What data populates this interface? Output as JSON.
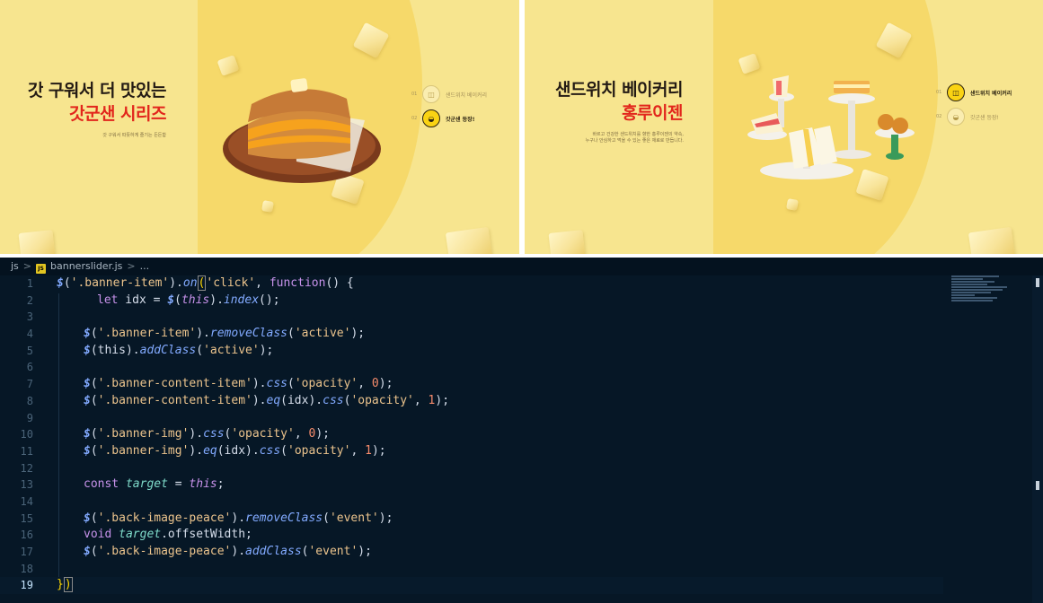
{
  "banner_left": {
    "title_line1": "갓 구워서 더 맛있는",
    "title_line2": "갓군샌 시리즈",
    "subtitle": "갓 구워서 따뜻하게 즐기는 든든함",
    "nav": [
      {
        "num": "01",
        "label": "샌드위치 베이커리",
        "active": false
      },
      {
        "num": "02",
        "label": "갓군샌 등장!",
        "active": true
      }
    ]
  },
  "banner_right": {
    "title_line1": "샌드위치 베이커리",
    "title_line2": "홍루이젠",
    "subtitle_line1": "바르고 건강한 샌드위치를 향한 홍루이젠의 약속,",
    "subtitle_line2": "누구나 안심하고 먹을 수 있는 좋은 재료로 만듭니다.",
    "nav": [
      {
        "num": "01",
        "label": "샌드위치 베이커리",
        "active": true
      },
      {
        "num": "02",
        "label": "갓군샌 등장!",
        "active": false
      }
    ]
  },
  "editor": {
    "breadcrumb": [
      "js",
      "bannerslider.js",
      "..."
    ],
    "file_badge": "JS",
    "line_numbers": [
      "1",
      "2",
      "3",
      "4",
      "5",
      "6",
      "7",
      "8",
      "9",
      "10",
      "11",
      "12",
      "13",
      "14",
      "15",
      "16",
      "17",
      "18",
      "19"
    ],
    "current_line": 19,
    "code": {
      "l1": {
        "dollar": "$",
        "p1": "(",
        "s1": "'.banner-item'",
        "p2": ").",
        "fn": "on",
        "brk": "(",
        "s2": "'click'",
        "p3": ", ",
        "kw": "function",
        "p4": "() {"
      },
      "l2": {
        "kw": "let",
        "v": " idx = ",
        "dollar": "$",
        "p1": "(",
        "this": "this",
        "p2": ").",
        "fn": "index",
        "p3": "();"
      },
      "l4": {
        "dollar": "$",
        "p1": "(",
        "s1": "'.banner-item'",
        "p2": ").",
        "fn": "removeClass",
        "p3": "(",
        "s2": "'active'",
        "p4": ");"
      },
      "l5": {
        "dollar": "$",
        "p1": "(this).",
        "fn": "addClass",
        "p2": "(",
        "s1": "'active'",
        "p3": ");"
      },
      "l7": {
        "dollar": "$",
        "p1": "(",
        "s1": "'.banner-content-item'",
        "p2": ").",
        "fn": "css",
        "p3": "(",
        "s2": "'opacity'",
        "p4": ", ",
        "n": "0",
        "p5": ");"
      },
      "l8": {
        "dollar": "$",
        "p1": "(",
        "s1": "'.banner-content-item'",
        "p2": ").",
        "fn": "eq",
        "p3": "(idx).",
        "fn2": "css",
        "p4": "(",
        "s2": "'opacity'",
        "p5": ", ",
        "n": "1",
        "p6": ");"
      },
      "l10": {
        "dollar": "$",
        "p1": "(",
        "s1": "'.banner-img'",
        "p2": ").",
        "fn": "css",
        "p3": "(",
        "s2": "'opacity'",
        "p4": ", ",
        "n": "0",
        "p5": ");"
      },
      "l11": {
        "dollar": "$",
        "p1": "(",
        "s1": "'.banner-img'",
        "p2": ").",
        "fn": "eq",
        "p3": "(idx).",
        "fn2": "css",
        "p4": "(",
        "s2": "'opacity'",
        "p5": ", ",
        "n": "1",
        "p6": ");"
      },
      "l13": {
        "kw": "const",
        "sp": " ",
        "v": "target",
        "eq": " = ",
        "this": "this",
        "end": ";"
      },
      "l15": {
        "dollar": "$",
        "p1": "(",
        "s1": "'.back-image-peace'",
        "p2": ").",
        "fn": "removeClass",
        "p3": "(",
        "s2": "'event'",
        "p4": ");"
      },
      "l16": {
        "kw": "void",
        "sp": " ",
        "v": "target",
        "prop": ".offsetWidth;"
      },
      "l17": {
        "dollar": "$",
        "p1": "(",
        "s1": "'.back-image-peace'",
        "p2": ").",
        "fn": "addClass",
        "p3": "(",
        "s2": "'event'",
        "p4": ");"
      },
      "l19": {
        "p1": "}",
        "brk": ")"
      }
    }
  }
}
